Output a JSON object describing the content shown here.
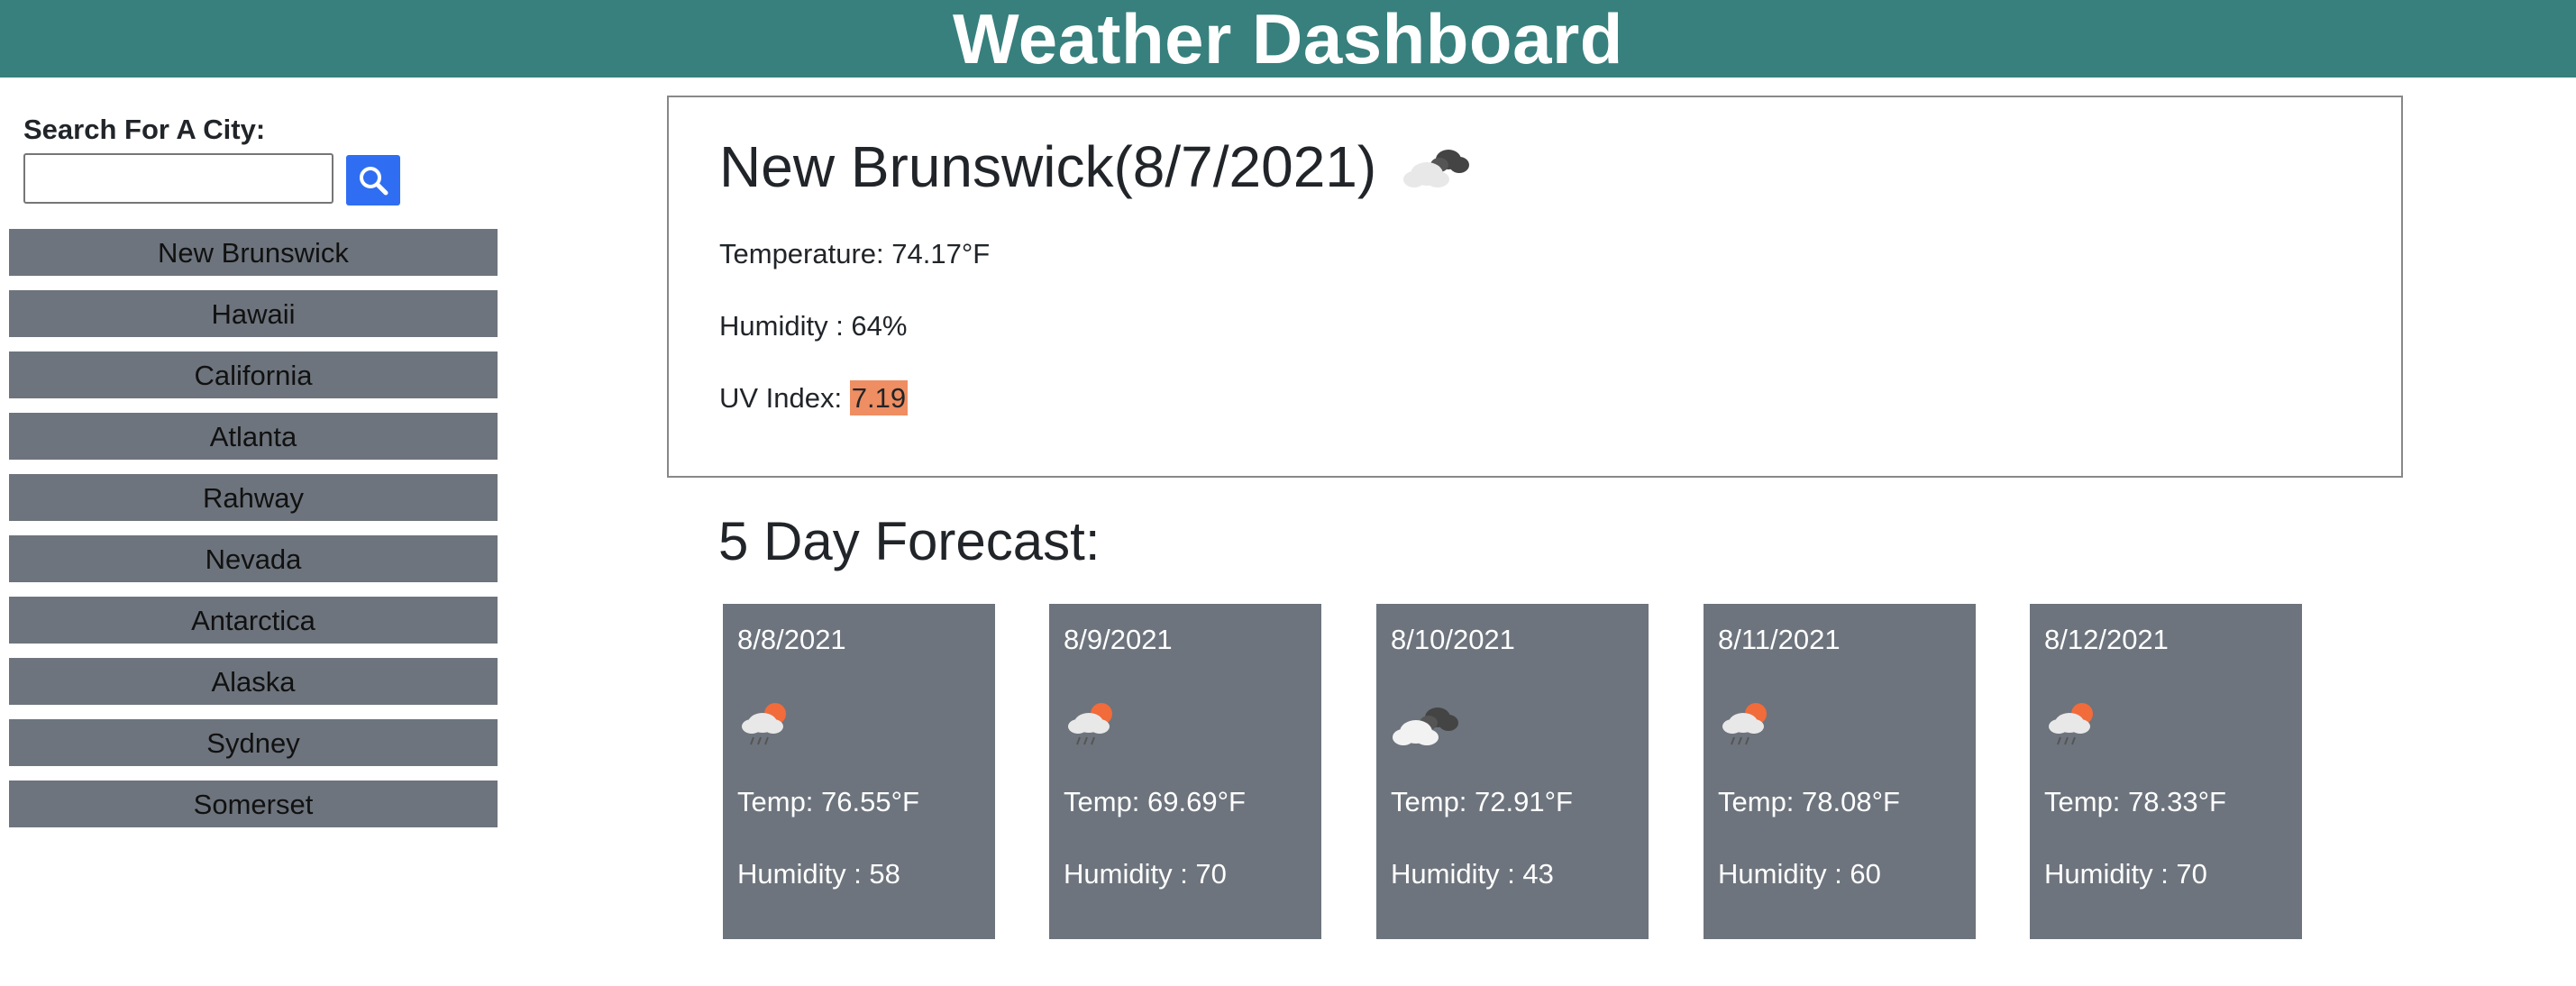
{
  "header": {
    "title": "Weather Dashboard"
  },
  "search": {
    "label": "Search For A City:",
    "value": "",
    "placeholder": "",
    "icon": "search-icon"
  },
  "cities": [
    "New Brunswick",
    "Hawaii",
    "California",
    "Atlanta",
    "Rahway",
    "Nevada",
    "Antarctica",
    "Alaska",
    "Sydney",
    "Somerset"
  ],
  "current": {
    "title": "New Brunswick(8/7/2021)",
    "icon": "broken-clouds-icon",
    "temperature": "Temperature: 74.17°F",
    "humidity": "Humidity : 64%",
    "uv_label": "UV Index: ",
    "uv_value": "7.19",
    "uv_color": "#ee8e62"
  },
  "forecast": {
    "title": "5 Day Forecast:",
    "days": [
      {
        "date": "8/8/2021",
        "icon": "rain-sun-icon",
        "temp": "Temp: 76.55°F",
        "humidity": "Humidity : 58"
      },
      {
        "date": "8/9/2021",
        "icon": "rain-sun-icon",
        "temp": "Temp: 69.69°F",
        "humidity": "Humidity : 70"
      },
      {
        "date": "8/10/2021",
        "icon": "broken-clouds-icon",
        "temp": "Temp: 72.91°F",
        "humidity": "Humidity : 43"
      },
      {
        "date": "8/11/2021",
        "icon": "rain-sun-icon",
        "temp": "Temp: 78.08°F",
        "humidity": "Humidity : 60"
      },
      {
        "date": "8/12/2021",
        "icon": "rain-sun-icon",
        "temp": "Temp: 78.33°F",
        "humidity": "Humidity : 70"
      }
    ]
  },
  "colors": {
    "header_bg": "#37807d",
    "button_blue": "#2f6ef2",
    "card_bg": "#6d747d"
  }
}
